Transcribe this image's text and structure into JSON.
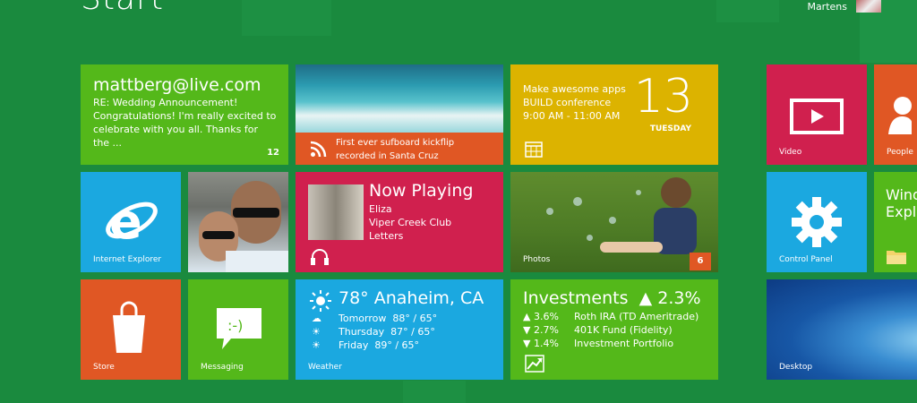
{
  "header": {
    "title": "Start",
    "user_name": "Martens"
  },
  "tiles": {
    "mail": {
      "address": "mattberg@live.com",
      "subject": "RE: Wedding Announcement!",
      "preview": "Congratulations! I'm really excited to celebrate with you all. Thanks for the ...",
      "count": "12",
      "icon": "mail-icon"
    },
    "news": {
      "caption_line1": "First ever sufboard kickflip",
      "caption_line2": "recorded in Santa Cruz",
      "icon": "rss-icon"
    },
    "calendar": {
      "line1": "Make awesome apps",
      "line2": "BUILD conference",
      "line3": "9:00 AM - 11:00 AM",
      "date_number": "13",
      "day": "TUESDAY",
      "icon": "calendar-icon"
    },
    "video": {
      "label": "Video",
      "icon": "play-icon"
    },
    "people": {
      "label": "People",
      "icon": "person-icon"
    },
    "ie": {
      "label": "Internet Explorer",
      "icon": "ie-icon"
    },
    "music": {
      "title": "Now Playing",
      "artist": "Eliza",
      "album": "Viper Creek Club",
      "track": "Letters",
      "icon": "headphones-icon"
    },
    "photos": {
      "label": "Photos",
      "count": "6"
    },
    "control_panel": {
      "label": "Control Panel",
      "icon": "gear-icon"
    },
    "windows_explorer": {
      "label_line1": "Wind",
      "label_line2": "Explo"
    },
    "store": {
      "label": "Store",
      "icon": "shopping-bag-icon"
    },
    "messaging": {
      "label": "Messaging",
      "icon": "speech-bubble-icon"
    },
    "weather": {
      "current": "78° Anaheim, CA",
      "forecast": [
        {
          "day": "Tomorrow",
          "temps": "88° / 65°"
        },
        {
          "day": "Thursday",
          "temps": "87° / 65°"
        },
        {
          "day": "Friday",
          "temps": "89° / 65°"
        }
      ],
      "label": "Weather"
    },
    "investments": {
      "title": "Investments",
      "change": "▲ 2.3%",
      "holdings": [
        {
          "change": "▲ 3.6%",
          "name": "Roth IRA (TD Ameritrade)"
        },
        {
          "change": "▼ 2.7%",
          "name": "401K Fund (Fidelity)"
        },
        {
          "change": "▼ 1.4%",
          "name": "Investment Portfolio"
        }
      ],
      "icon": "chart-up-icon"
    },
    "desktop": {
      "label": "Desktop"
    }
  },
  "colors": {
    "background": "#1a8a3e",
    "mail": "#54b81a",
    "orange": "#e05724",
    "yellow": "#dcb300",
    "red": "#d0204e",
    "blue": "#1ba8e0",
    "green": "#54b81a"
  }
}
